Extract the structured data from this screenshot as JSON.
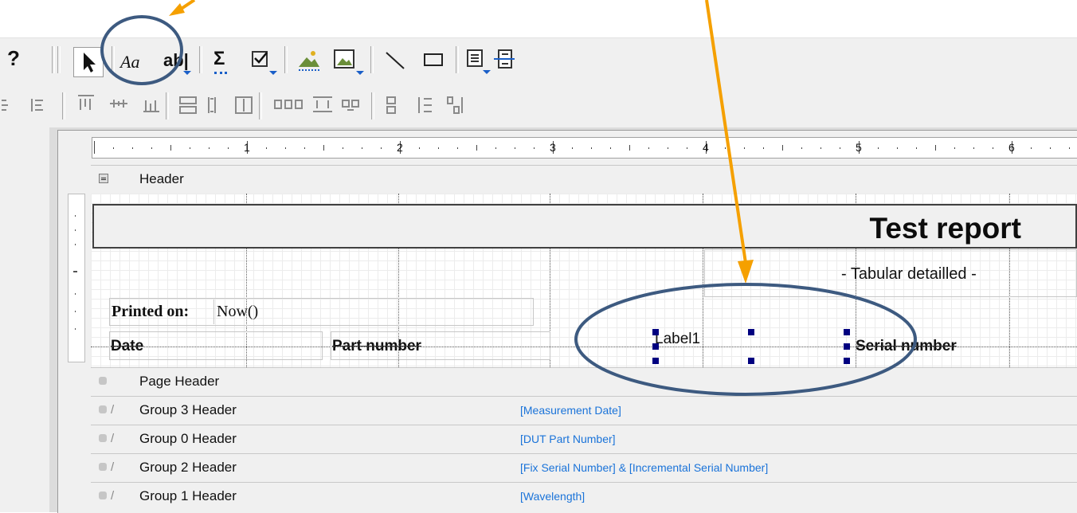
{
  "toolbar": {
    "help_glyph": "?",
    "label_tool_text": "Aa",
    "textbox_tool_text": "ab|",
    "sum_glyph": "Σ"
  },
  "ruler": {
    "marks": [
      "1",
      "2",
      "3",
      "4",
      "5",
      "6"
    ]
  },
  "sections": {
    "header": "Header",
    "page_header": "Page Header",
    "groups": [
      {
        "label": "Group 3 Header",
        "expression": "[Measurement Date]"
      },
      {
        "label": "Group 0 Header",
        "expression": "[DUT Part Number]"
      },
      {
        "label": "Group 2 Header",
        "expression": "[Fix Serial Number] & [Incremental Serial Number]"
      },
      {
        "label": "Group 1 Header",
        "expression": "[Wavelength]"
      }
    ]
  },
  "report": {
    "title": "Test report",
    "subtitle": "- Tabular detailled -",
    "printed_on_label": "Printed on:",
    "printed_on_value": "Now()",
    "columns": {
      "date": "Date",
      "part_number": "Part number",
      "selected_label": "Label1",
      "serial_number": "Serial number"
    }
  },
  "colors": {
    "annotation_arrow": "#f5a000",
    "annotation_ellipse": "#3d5a80",
    "selection_handle": "#000080",
    "expression_text": "#1a73d9"
  }
}
